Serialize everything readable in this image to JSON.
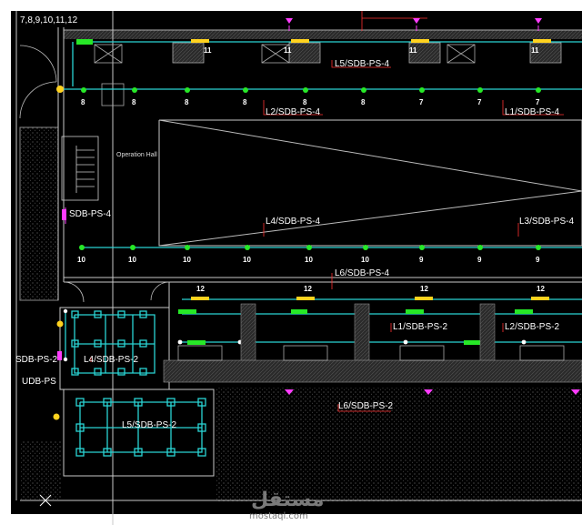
{
  "title": "7,8,9,10,11,12",
  "circuit_labels": {
    "l5_top": "L5/SDB-PS-4",
    "l2_top": "L2/SDB-PS-4",
    "l1_top": "L1/SDB-PS-4",
    "l4_mid": "L4/SDB-PS-4",
    "l3_mid": "L3/SDB-PS-4",
    "l6_mid": "L6/SDB-PS-4",
    "l1_ps2": "L1/SDB-PS-2",
    "l2_ps2": "L2/SDB-PS-2",
    "l4_ps2": "L4/SDB-PS-2",
    "l5_ps2": "L5/SDB-PS-2",
    "l6_ps2": "L6/SDB-PS-2",
    "sdb_ps4": "SDB-PS-4",
    "sdb_ps2": "SDB-PS-2",
    "udb_ps": "UDB-PS"
  },
  "room_labels": {
    "operation_hall": "Operation Hall"
  },
  "row1_numbers": [
    "8",
    "8",
    "8",
    "8",
    "8",
    "8",
    "7",
    "7",
    "7"
  ],
  "row2_numbers": [
    "10",
    "10",
    "10",
    "10",
    "10",
    "10",
    "9",
    "9",
    "9"
  ],
  "row3_numbers": [
    "12",
    "12",
    "12",
    "12"
  ],
  "top_numbers": [
    "11",
    "11",
    "11",
    "11"
  ],
  "watermark": {
    "arabic": "مستقل",
    "latin": "mostaql.com"
  }
}
